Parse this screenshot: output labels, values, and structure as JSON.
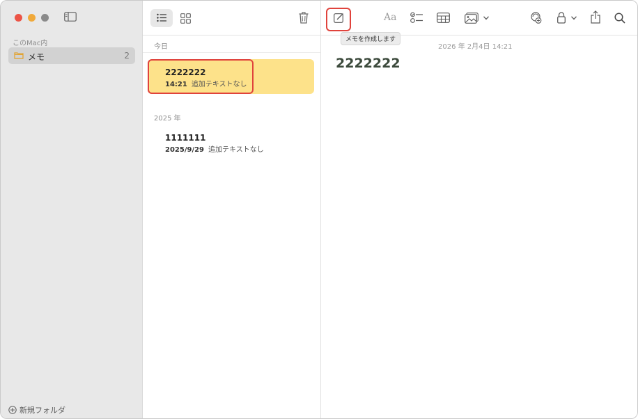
{
  "sidebar": {
    "section_label": "このMac内",
    "folder": {
      "name": "メモ",
      "count": "2"
    },
    "new_folder_label": "新規フォルダ"
  },
  "notelist": {
    "groups": [
      {
        "label": "今日",
        "notes": [
          {
            "title": "2222222",
            "date": "14:21",
            "preview": "追加テキストなし",
            "selected": true
          }
        ]
      },
      {
        "label": "2025 年",
        "notes": [
          {
            "title": "1111111",
            "date": "2025/9/29",
            "preview": "追加テキストなし",
            "selected": false
          }
        ]
      }
    ]
  },
  "editor": {
    "tooltip": "メモを作成します",
    "date": "2026 年 2月4日 14:21",
    "heading": "2222222",
    "format_label": "Aa"
  },
  "colors": {
    "accent_highlight": "#e0433c",
    "selected_note": "#fde28a",
    "sidebar_bg": "#e8e8e8"
  },
  "icons": [
    "sidebar-toggle-icon",
    "folder-icon",
    "plus-circle-icon",
    "list-view-icon",
    "gallery-view-icon",
    "trash-icon",
    "compose-icon",
    "format-icon",
    "checklist-icon",
    "table-icon",
    "media-icon",
    "chevron-down-icon",
    "collaborate-icon",
    "lock-icon",
    "share-icon",
    "search-icon"
  ]
}
